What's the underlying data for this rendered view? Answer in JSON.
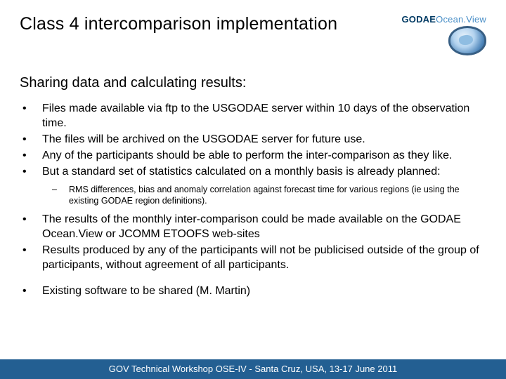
{
  "brand": {
    "bold": "GODAE",
    "light": "Ocean.View"
  },
  "title": "Class 4 intercomparison implementation",
  "subtitle": "Sharing data and calculating results:",
  "bullets": [
    "Files made available via ftp to the USGODAE server within 10 days of the observation time.",
    "The files will be archived on the USGODAE server for future use.",
    "Any of the participants should be able to perform the inter-comparison as they like.",
    "But a standard set of statistics calculated on a monthly basis is already planned:"
  ],
  "sub_bullets": [
    "RMS differences, bias and anomaly correlation against forecast time for various regions (ie using the existing GODAE region definitions)."
  ],
  "bullets2": [
    "The results of the monthly inter-comparison could be made available on the GODAE Ocean.View or JCOMM ETOOFS web-sites",
    "Results produced by any of the participants will not be publicised outside of the group of participants, without agreement of all participants."
  ],
  "bullets3": [
    "Existing software to be shared (M. Martin)"
  ],
  "footer": "GOV Technical Workshop OSE-IV - Santa Cruz, USA, 13-17 June 2011"
}
